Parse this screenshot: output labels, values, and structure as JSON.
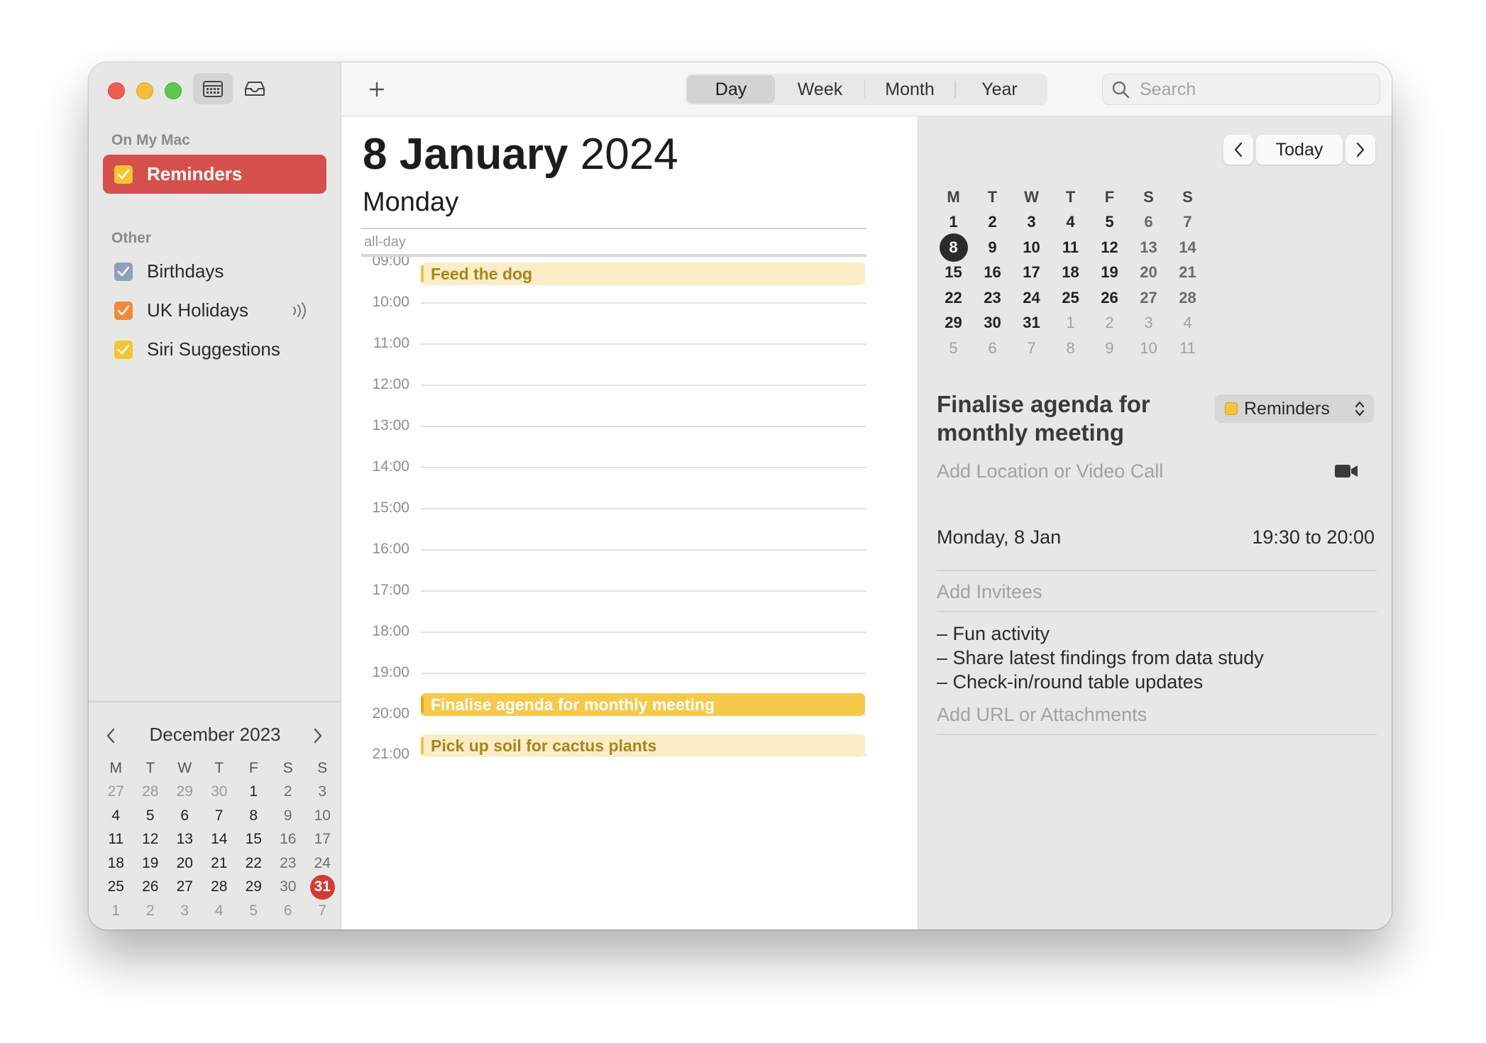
{
  "sidebar": {
    "section_on_my_mac": "On My Mac",
    "section_other": "Other",
    "calendars": [
      {
        "name": "Reminders",
        "color": "#f5c433",
        "selected": true
      },
      {
        "name": "Birthdays",
        "color": "#8f9fbc"
      },
      {
        "name": "UK Holidays",
        "color": "#ef8a3c"
      },
      {
        "name": "Siri Suggestions",
        "color": "#f5c433"
      }
    ],
    "mini_calendar": {
      "title": "December 2023",
      "weekdays": [
        "M",
        "T",
        "W",
        "T",
        "F",
        "S",
        "S"
      ],
      "weeks": [
        [
          "27",
          "28",
          "29",
          "30",
          "1",
          "2",
          "3"
        ],
        [
          "4",
          "5",
          "6",
          "7",
          "8",
          "9",
          "10"
        ],
        [
          "11",
          "12",
          "13",
          "14",
          "15",
          "16",
          "17"
        ],
        [
          "18",
          "19",
          "20",
          "21",
          "22",
          "23",
          "24"
        ],
        [
          "25",
          "26",
          "27",
          "28",
          "29",
          "30",
          "31"
        ],
        [
          "1",
          "2",
          "3",
          "4",
          "5",
          "6",
          "7"
        ]
      ],
      "today": "31"
    }
  },
  "toolbar": {
    "views": [
      "Day",
      "Week",
      "Month",
      "Year"
    ],
    "active_view": "Day",
    "search_placeholder": "Search"
  },
  "day": {
    "date_bold": "8 January",
    "year": "2024",
    "weekday": "Monday",
    "allday_label": "all-day",
    "hours": [
      "09:00",
      "10:00",
      "11:00",
      "12:00",
      "13:00",
      "14:00",
      "15:00",
      "16:00",
      "17:00",
      "18:00",
      "19:00",
      "20:00",
      "21:00"
    ],
    "events": [
      {
        "title": "Feed the dog",
        "style": "light"
      },
      {
        "title": "Finalise agenda for monthly meeting",
        "style": "solid"
      },
      {
        "title": "Pick up soil for cactus plants",
        "style": "light"
      }
    ]
  },
  "inspector": {
    "today_label": "Today",
    "month_weekdays": [
      "M",
      "T",
      "W",
      "T",
      "F",
      "S",
      "S"
    ],
    "month_weeks": [
      [
        "1",
        "2",
        "3",
        "4",
        "5",
        "6",
        "7"
      ],
      [
        "8",
        "9",
        "10",
        "11",
        "12",
        "13",
        "14"
      ],
      [
        "15",
        "16",
        "17",
        "18",
        "19",
        "20",
        "21"
      ],
      [
        "22",
        "23",
        "24",
        "25",
        "26",
        "27",
        "28"
      ],
      [
        "29",
        "30",
        "31",
        "1",
        "2",
        "3",
        "4"
      ],
      [
        "5",
        "6",
        "7",
        "8",
        "9",
        "10",
        "11"
      ]
    ],
    "selected_day": "8",
    "event": {
      "title": "Finalise agenda for monthly meeting",
      "calendar": "Reminders",
      "location_placeholder": "Add Location or Video Call",
      "date": "Monday, 8 Jan",
      "time": "19:30 to 20:00",
      "invitees_placeholder": "Add Invitees",
      "notes": [
        "– Fun activity",
        "– Share latest findings from data study",
        "– Check-in/round table updates"
      ],
      "url_placeholder": "Add URL or Attachments"
    }
  }
}
